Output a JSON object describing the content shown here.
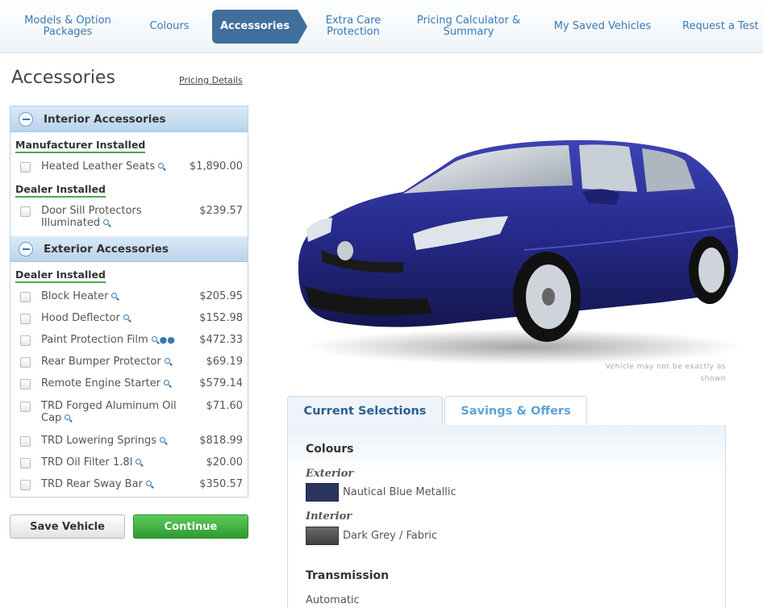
{
  "nav": {
    "steps": [
      {
        "label": "Models & Option Packages"
      },
      {
        "label": "Colours"
      },
      {
        "label": "Accessories"
      },
      {
        "label": "Extra Care Protection"
      },
      {
        "label": "Pricing Calculator & Summary"
      },
      {
        "label": "My Saved Vehicles"
      },
      {
        "label": "Request a Test"
      }
    ],
    "active_index": 2,
    "accent_color": "#3f6f9c"
  },
  "accessories": {
    "title": "Accessories",
    "pricing_details_link": "Pricing Details",
    "sections": [
      {
        "label": "Interior Accessories",
        "groups": [
          {
            "label": "Manufacturer Installed",
            "items": [
              {
                "name": "Heated Leather Seats",
                "price": "$1,890.00"
              }
            ]
          },
          {
            "label": "Dealer Installed",
            "items": [
              {
                "name": "Door Sill Protectors Illuminated",
                "price": "$239.57"
              }
            ]
          }
        ]
      },
      {
        "label": "Exterior Accessories",
        "groups": [
          {
            "label": "Dealer Installed",
            "items": [
              {
                "name": "Block Heater",
                "price": "$205.95"
              },
              {
                "name": "Hood Deflector",
                "price": "$152.98"
              },
              {
                "name": "Paint Protection Film",
                "price": "$472.33"
              },
              {
                "name": "Rear Bumper Protector",
                "price": "$69.19"
              },
              {
                "name": "Remote Engine Starter",
                "price": "$579.14"
              },
              {
                "name": "TRD Forged Aluminum Oil Cap",
                "price": "$71.60"
              },
              {
                "name": "TRD Lowering Springs",
                "price": "$818.99"
              },
              {
                "name": "TRD Oil Filter 1.8l",
                "price": "$20.00"
              },
              {
                "name": "TRD Rear Sway Bar",
                "price": "$350.57"
              }
            ]
          }
        ]
      }
    ]
  },
  "buttons": {
    "save": "Save Vehicle",
    "continue": "Continue"
  },
  "vehicle": {
    "disclaimer": "Vehicle may not be exactly as shown",
    "body_color": "#2b2f8a"
  },
  "selections": {
    "tabs": [
      {
        "label": "Current Selections"
      },
      {
        "label": "Savings & Offers"
      }
    ],
    "colours_heading": "Colours",
    "exterior_label": "Exterior",
    "exterior_value": "Nautical Blue Metallic",
    "exterior_swatch": "#2a3560",
    "interior_label": "Interior",
    "interior_value": "Dark Grey / Fabric",
    "interior_swatch": "#555555",
    "transmission_heading": "Transmission",
    "transmission_value": "Automatic"
  }
}
